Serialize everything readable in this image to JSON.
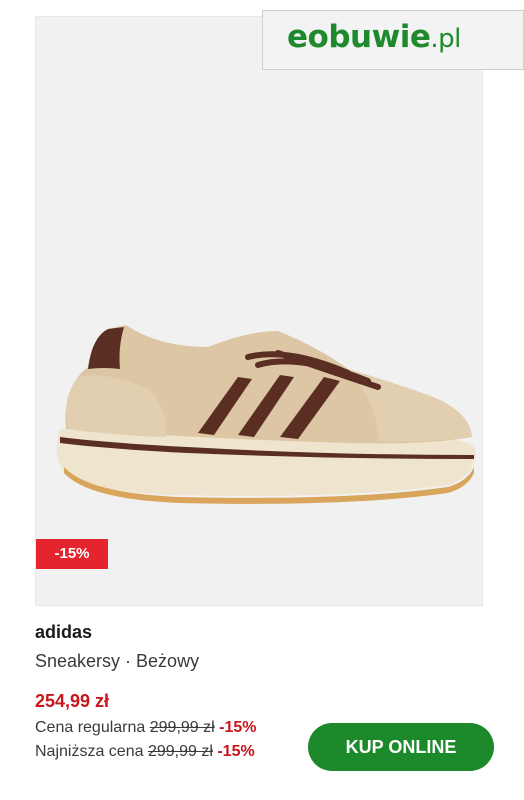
{
  "brand_logo": {
    "main": "eobuwie",
    "tld": ".pl"
  },
  "product": {
    "badge": "-15%",
    "brand": "adidas",
    "subtitle": "Sneakersy · Beżowy",
    "price": "254,99 zł",
    "regular_label": "Cena regularna",
    "regular_price": "299,99 zł",
    "regular_discount": "-15%",
    "lowest_label": "Najniższa cena",
    "lowest_price": "299,99 zł",
    "lowest_discount": "-15%"
  },
  "cta": {
    "label": "KUP ONLINE"
  },
  "colors": {
    "accent_green": "#1c8a2a",
    "sale_red": "#e5252d",
    "price_red": "#c8161d"
  }
}
